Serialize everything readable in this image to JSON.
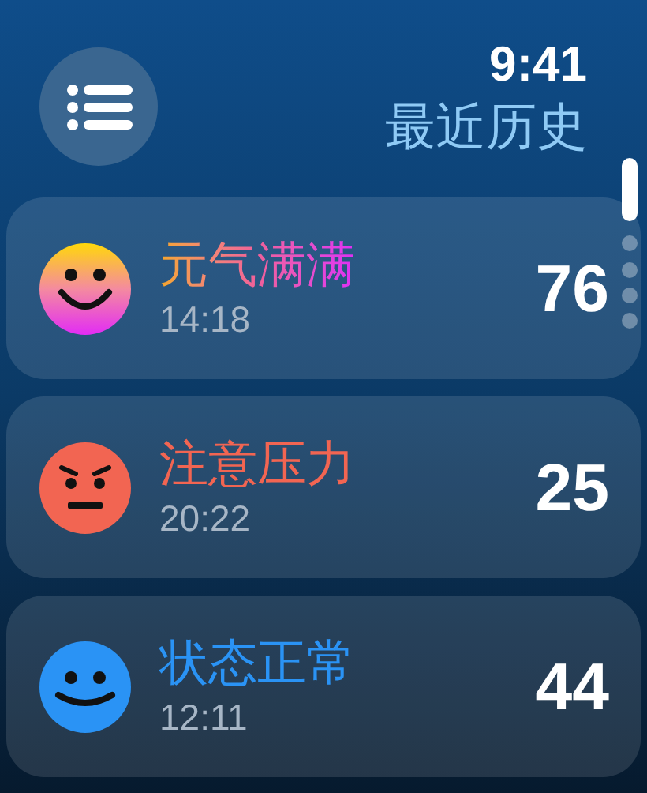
{
  "header": {
    "time": "9:41",
    "title": "最近历史"
  },
  "entries": [
    {
      "kind": "joyful",
      "label": "元气满满",
      "time": "14:18",
      "score": "76"
    },
    {
      "kind": "stressed",
      "label": "注意压力",
      "time": "20:22",
      "score": "25"
    },
    {
      "kind": "calm",
      "label": "状态正常",
      "time": "12:11",
      "score": "44"
    }
  ]
}
